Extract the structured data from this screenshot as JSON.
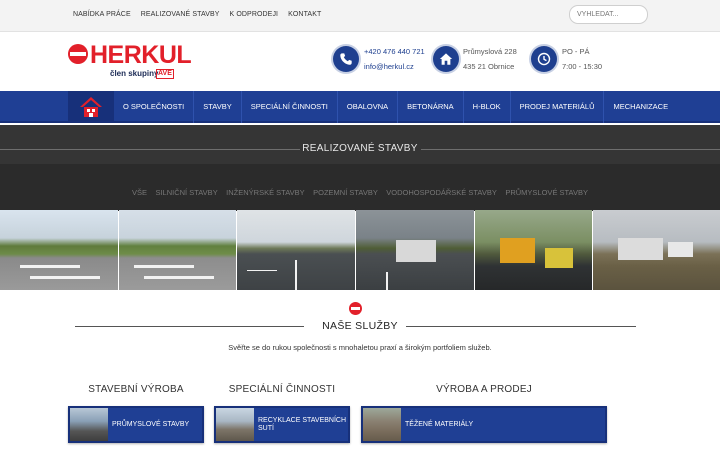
{
  "topbar": {
    "links": [
      "NABÍDKA PRÁCE",
      "REALIZOVANÉ STAVBY",
      "K ODPRODEJI",
      "KONTAKT"
    ],
    "search_placeholder": "VYHLEDAT..."
  },
  "header": {
    "logo_text": "HERKUL",
    "logo_sub": "člen skupiny",
    "logo_badge": "AVE",
    "phone": "+420 476 440 721",
    "email": "info@herkul.cz",
    "address_line1": "Průmyslová 228",
    "address_line2": "435 21 Obrnice",
    "hours_days": "PO - PÁ",
    "hours_time": "7:00 - 15:30"
  },
  "nav": {
    "items": [
      "O SPOLEČNOSTI",
      "STAVBY",
      "SPECIÁLNÍ ČINNOSTI",
      "OBALOVNA",
      "BETONÁRNA",
      "H-BLOK",
      "PRODEJ MATERIÁLŮ",
      "MECHANIZACE"
    ]
  },
  "projects": {
    "title": "REALIZOVANÉ STAVBY",
    "filters": [
      "VŠE",
      "SILNIČNÍ STAVBY",
      "INŽENÝRSKÉ STAVBY",
      "POZEMNÍ STAVBY",
      "VODOHOSPODÁŘSKÉ STAVBY",
      "PRŮMYSLOVÉ STAVBY"
    ]
  },
  "services": {
    "title": "NAŠE SLUŽBY",
    "description": "Svěřte se do rukou společnosti s mnohaletou praxí a širokým portfoliem služeb.",
    "columns": [
      {
        "title": "STAVEBNÍ VÝROBA",
        "card": "PRŮMYSLOVÉ STAVBY"
      },
      {
        "title": "SPECIÁLNÍ ČINNOSTI",
        "card": "RECYKLACE STAVEBNÍCH SUTÍ"
      },
      {
        "title": "VÝROBA A PRODEJ",
        "card": "TĚŽENÉ MATERIÁLY"
      }
    ]
  },
  "colors": {
    "brand_red": "#e2202a",
    "brand_blue": "#1f3f94",
    "dark_band": "#2b2b2b"
  },
  "icons": [
    "phone-icon",
    "home-icon",
    "clock-icon",
    "house-logo-icon"
  ]
}
